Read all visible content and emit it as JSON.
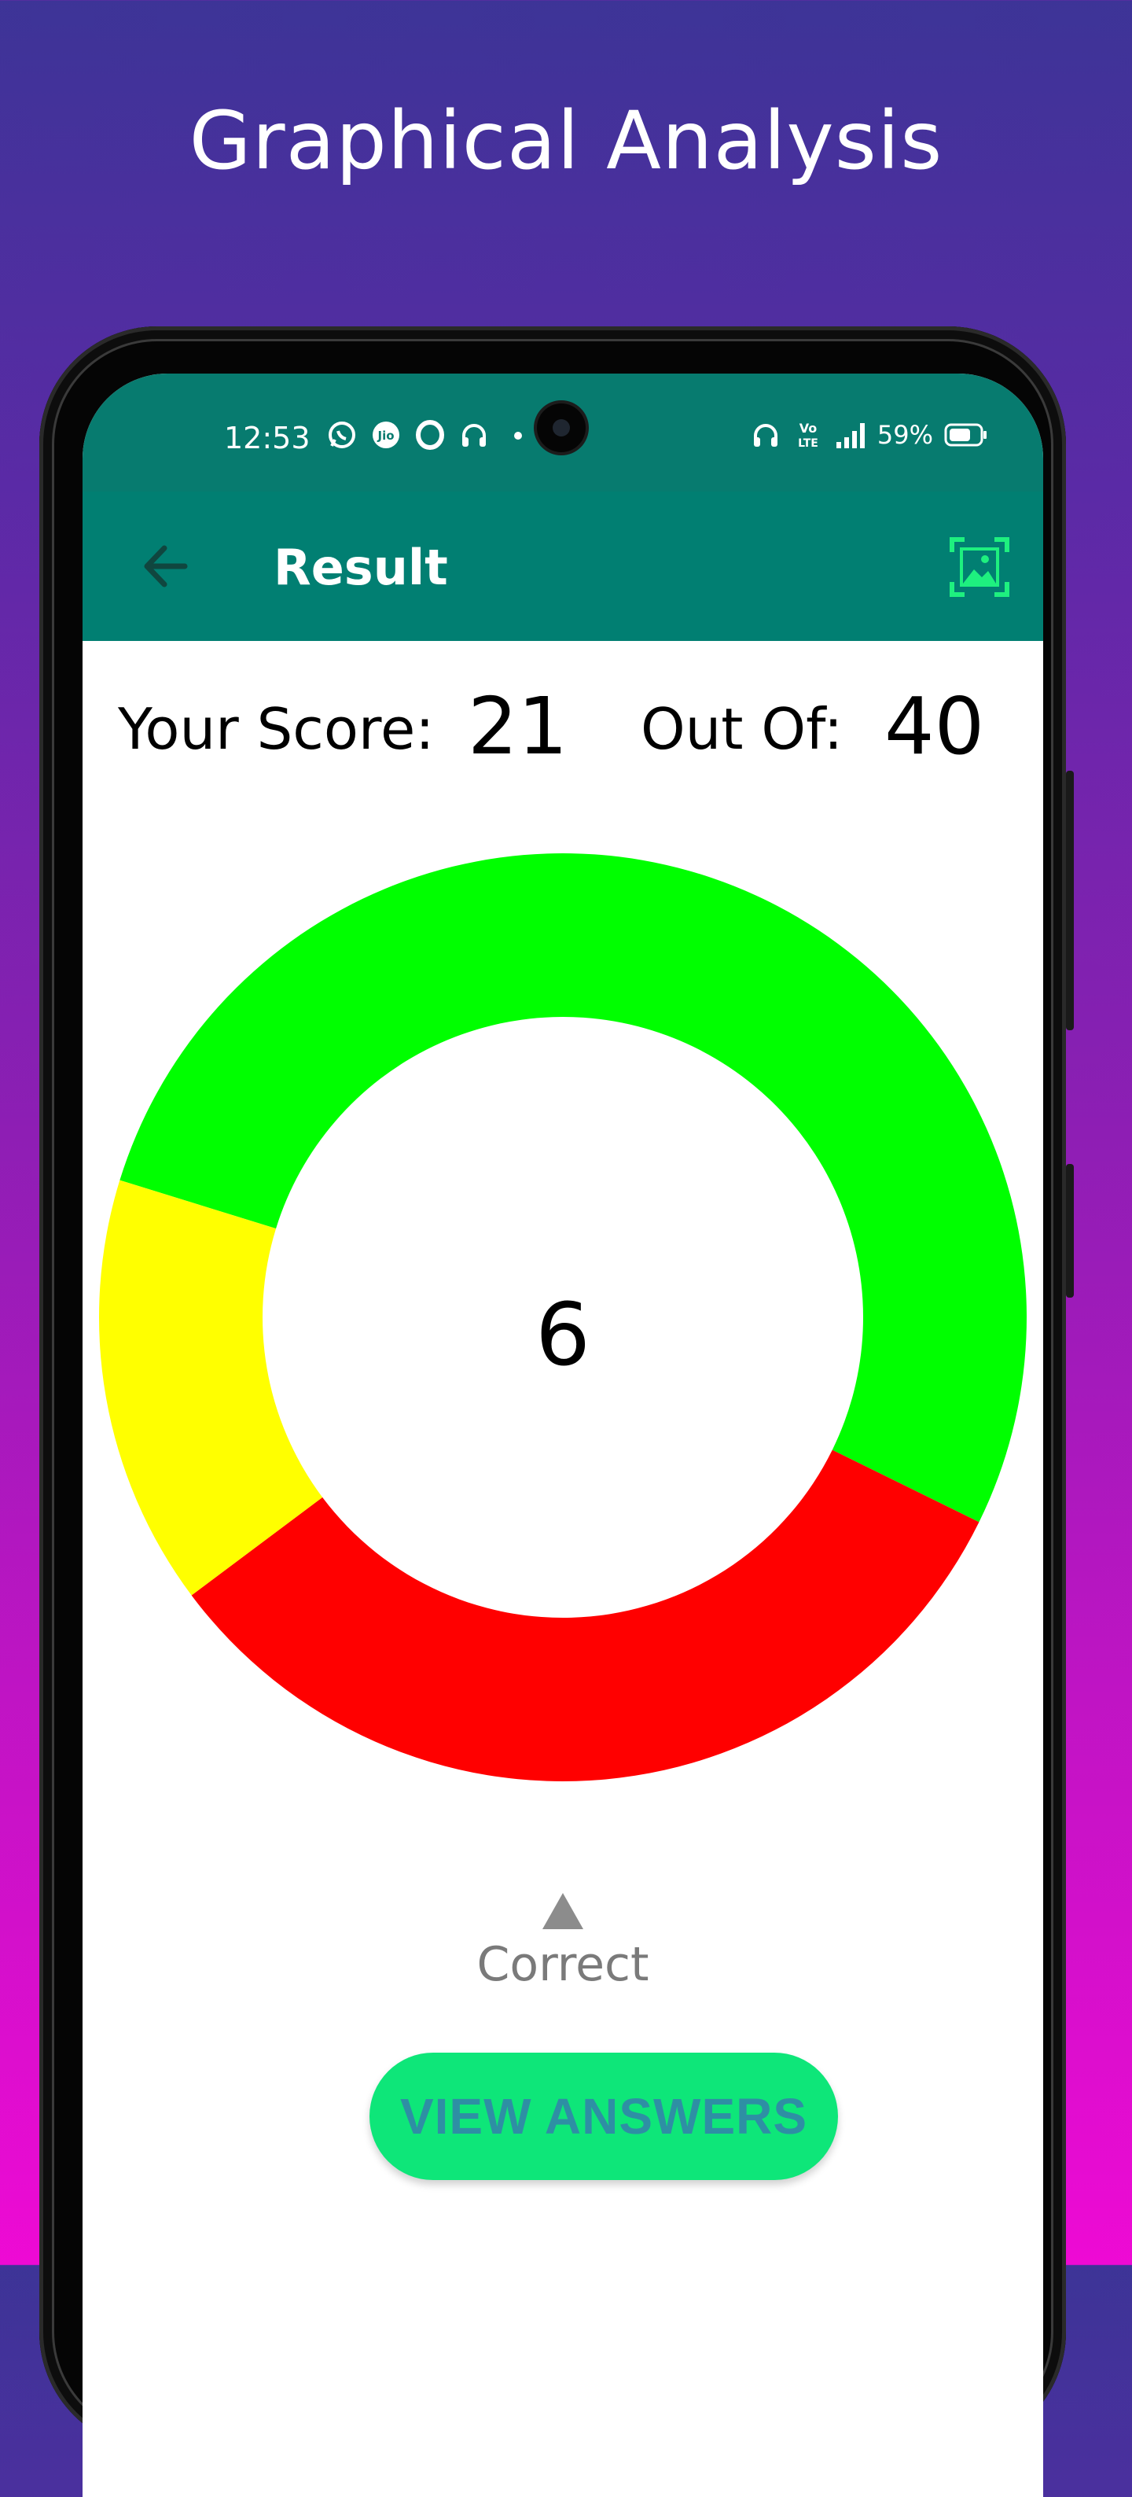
{
  "headline": "Graphical Analysis",
  "status": {
    "time": "12:53",
    "battery_pct": "59%",
    "left_icons": [
      "whatsapp-icon",
      "jio-icon",
      "opera-icon",
      "headphones-icon",
      "dot-icon"
    ],
    "right_icons": [
      "headphones-icon",
      "volte-icon",
      "signal-icon",
      "battery-icon"
    ]
  },
  "appbar": {
    "title": "Result",
    "back_icon": "arrow-left-icon",
    "action_icon": "image-frame-icon"
  },
  "score": {
    "your_label": "Your Score:",
    "your_value": "21",
    "outof_label": "Out Of:",
    "outof_value": "40"
  },
  "chart_data": {
    "type": "pie",
    "center_label": "6",
    "slices": [
      {
        "value": 21,
        "color": "#00ff00"
      },
      {
        "value": 13,
        "color": "#ff0000"
      },
      {
        "value": 6,
        "color": "#ffff00"
      }
    ]
  },
  "legend": {
    "label": "Correct",
    "marker_color": "#8c8c8c"
  },
  "view_button": {
    "label": "VIEW ANSWERS"
  },
  "colors": {
    "appbar": "#017f72",
    "button": "#0ee679",
    "button_text": "#2e8fa4"
  }
}
